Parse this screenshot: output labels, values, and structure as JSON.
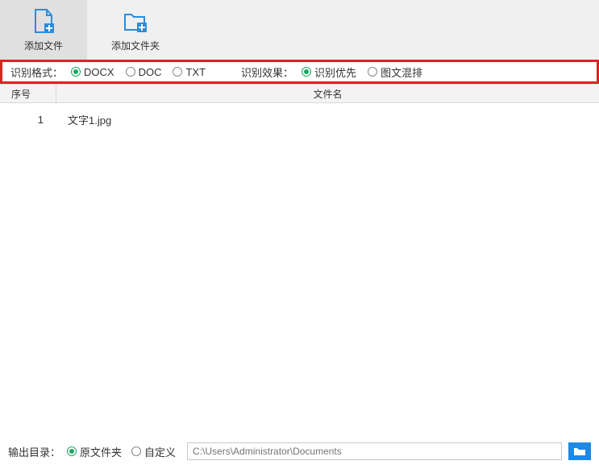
{
  "toolbar": {
    "add_file_label": "添加文件",
    "add_folder_label": "添加文件夹"
  },
  "options": {
    "format_label": "识别格式：",
    "formats": [
      {
        "label": "DOCX",
        "checked": true
      },
      {
        "label": "DOC",
        "checked": false
      },
      {
        "label": "TXT",
        "checked": false
      }
    ],
    "effect_label": "识别效果：",
    "effects": [
      {
        "label": "识别优先",
        "checked": true
      },
      {
        "label": "图文混排",
        "checked": false
      }
    ]
  },
  "table": {
    "header_seq": "序号",
    "header_name": "文件名",
    "rows": [
      {
        "seq": "1",
        "name": "文字1.jpg"
      }
    ]
  },
  "output": {
    "label": "输出目录：",
    "options": [
      {
        "label": "原文件夹",
        "checked": true
      },
      {
        "label": "自定义",
        "checked": false
      }
    ],
    "path_placeholder": "C:\\Users\\Administrator\\Documents"
  },
  "colors": {
    "accent_green": "#1aa860",
    "highlight_border": "#dd2222",
    "browse_blue": "#1e88e5"
  }
}
